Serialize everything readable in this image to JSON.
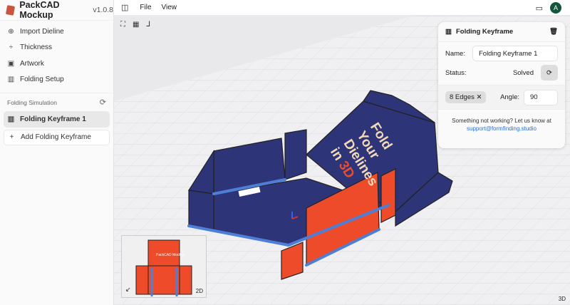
{
  "app": {
    "name": "PackCAD Mockup",
    "version": "v1.0.8"
  },
  "sidebar": {
    "items": [
      {
        "label": "Import Dieline",
        "icon": "import-icon"
      },
      {
        "label": "Thickness",
        "icon": "thickness-icon"
      },
      {
        "label": "Artwork",
        "icon": "image-icon"
      },
      {
        "label": "Folding Setup",
        "icon": "map-icon"
      }
    ],
    "section": "Folding Simulation",
    "keyframes": [
      {
        "label": "Folding Keyframe 1"
      }
    ],
    "add_label": "Add Folding Keyframe"
  },
  "menu": {
    "file": "File",
    "view": "View"
  },
  "user": {
    "initial": "A",
    "color": "#14553b"
  },
  "panel": {
    "title": "Folding Keyframe",
    "name_label": "Name:",
    "name_value": "Folding Keyframe 1",
    "status_label": "Status:",
    "status_value": "Solved",
    "edges_chip": "8 Edges",
    "angle_label": "Angle:",
    "angle_value": "90",
    "help_text": "Something not working? Let us know at",
    "help_link": "support@formfinding.studio"
  },
  "artwork": {
    "line1": "Fold",
    "line2": "Your",
    "line3": "Dielines",
    "line4a": "in ",
    "line4b": "3D",
    "mini_brand": "PackCAD Mockup"
  },
  "minimap": {
    "label": "2D"
  },
  "viewport": {
    "mode": "3D"
  },
  "colors": {
    "navy": "#2e3478",
    "red": "#ee4b2b",
    "cream": "#f4d9b8",
    "hinge": "#4d7fd6"
  }
}
